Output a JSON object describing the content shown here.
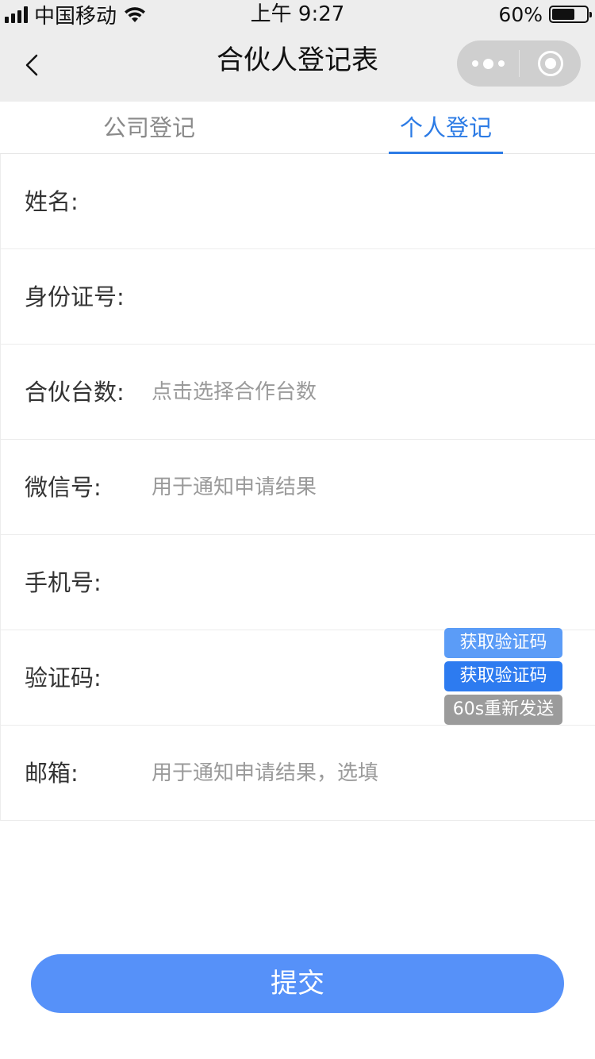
{
  "status_bar": {
    "carrier": "中国移动",
    "time": "上午 9:27",
    "battery": "60%",
    "battery_level": 0.6,
    "icons": [
      "signal-icon",
      "wifi-icon",
      "battery-icon"
    ]
  },
  "nav": {
    "title": "合伙人登记表",
    "icons": [
      "back-icon",
      "more-icon",
      "close-icon"
    ]
  },
  "tabs": [
    {
      "label": "公司登记",
      "active": false
    },
    {
      "label": "个人登记",
      "active": true
    }
  ],
  "form": {
    "name": {
      "label": "姓名:",
      "placeholder": ""
    },
    "id_number": {
      "label": "身份证号:",
      "placeholder": ""
    },
    "partner_count": {
      "label": "合伙台数:",
      "placeholder": "点击选择合作台数"
    },
    "wechat": {
      "label": "微信号:",
      "placeholder": "用于通知申请结果"
    },
    "phone": {
      "label": "手机号:",
      "placeholder": ""
    },
    "verify_code": {
      "label": "验证码:",
      "placeholder": "",
      "buttons": [
        "获取验证码",
        "获取验证码",
        "60s重新发送"
      ]
    },
    "email": {
      "label": "邮箱:",
      "placeholder": "用于通知申请结果，选填"
    }
  },
  "submit_label": "提交",
  "colors": {
    "accent": "#2c7be5",
    "submit": "#5691f9",
    "code_light": "#5b9cf7",
    "code_active": "#2d7bf0",
    "code_disabled": "#9b9b9b"
  }
}
